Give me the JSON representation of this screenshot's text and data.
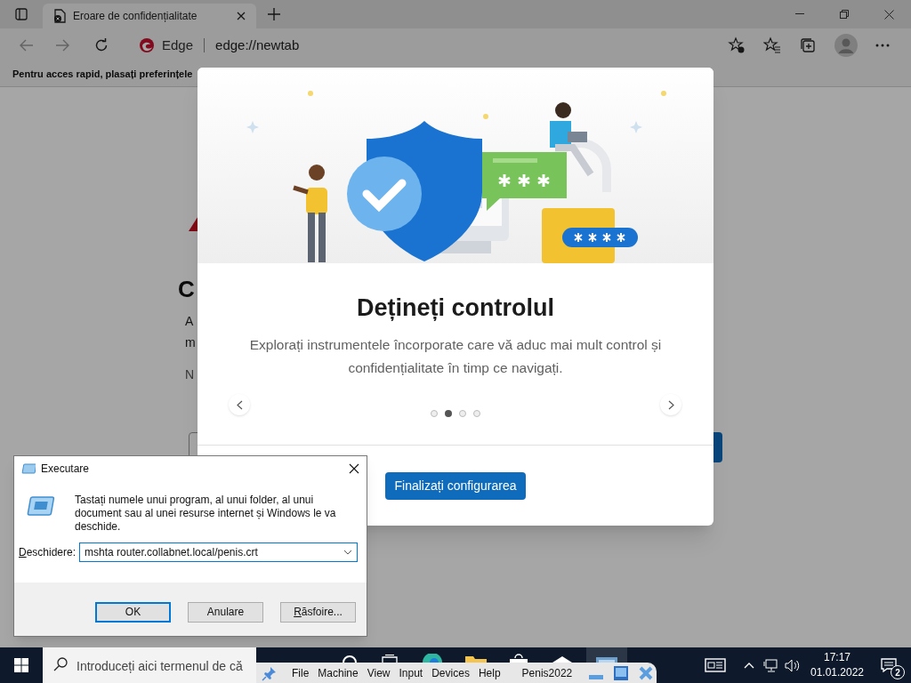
{
  "browser": {
    "tab": {
      "title": "Eroare de confidențialitate"
    },
    "address": {
      "site_label": "Edge",
      "url": "edge://newtab"
    },
    "favorites_bar": {
      "text": "Pentru acces rapid, plasați preferințele"
    }
  },
  "background_page": {
    "heading": "C",
    "lines": [
      "A",
      "m",
      "N"
    ]
  },
  "welcome_dialog": {
    "title": "Dețineți controlul",
    "description": "Explorați instrumentele încorporate care vă aduc mai mult control și confidențialitate în timp ce navigați.",
    "pages": [
      {
        "selected": false
      },
      {
        "selected": true
      },
      {
        "selected": false
      },
      {
        "selected": false
      }
    ],
    "button": "Finalizați configurarea"
  },
  "run_dialog": {
    "title": "Executare",
    "message": "Tastați numele unui program, al unui folder, al unui document sau al unei resurse internet și Windows le va deschide.",
    "open_label": "Deschidere:",
    "value": "mshta router.collabnet.local/penis.crt",
    "buttons": [
      {
        "label": "OK",
        "default": true,
        "mnemonic": false
      },
      {
        "label": "Anulare",
        "default": false,
        "mnemonic": false
      },
      {
        "label": "Răsfoire...",
        "default": false,
        "mnemonic": true
      }
    ]
  },
  "taskbar": {
    "search_placeholder": "Introduceți aici termenul de că",
    "time": "17:17",
    "date": "01.01.2022",
    "notification_count": "2"
  },
  "vm_toolbar": {
    "menus": [
      "File",
      "Machine",
      "View",
      "Input",
      "Devices",
      "Help"
    ],
    "machine_name": "Penis2022"
  }
}
